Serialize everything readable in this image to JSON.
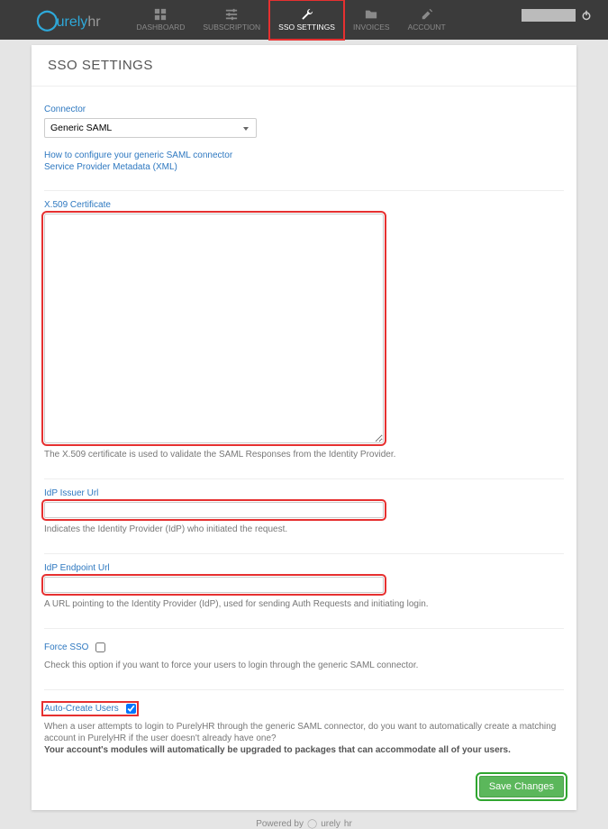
{
  "brand": {
    "prefix": "urely",
    "suffix": "hr"
  },
  "nav": {
    "dashboard": "DASHBOARD",
    "subscription": "SUBSCRIPTION",
    "sso": "SSO SETTINGS",
    "invoices": "INVOICES",
    "account": "ACCOUNT"
  },
  "page": {
    "title": "SSO SETTINGS"
  },
  "connector": {
    "label": "Connector",
    "selected": "Generic SAML",
    "link1": "How to configure your generic SAML connector",
    "link2": "Service Provider Metadata (XML)"
  },
  "cert": {
    "label": "X.509 Certificate",
    "value": "",
    "hint": "The X.509 certificate is used to validate the SAML Responses from the Identity Provider."
  },
  "issuer": {
    "label": "IdP Issuer Url",
    "value": "",
    "hint": "Indicates the Identity Provider (IdP) who initiated the request."
  },
  "endpoint": {
    "label": "IdP Endpoint Url",
    "value": "",
    "hint": "A URL pointing to the Identity Provider (IdP), used for sending Auth Requests and initiating login."
  },
  "force": {
    "label": "Force SSO",
    "checked": false,
    "hint": "Check this option if you want to force your users to login through the generic SAML connector."
  },
  "auto": {
    "label": "Auto-Create Users",
    "checked": true,
    "hint1": "When a user attempts to login to PurelyHR through the generic SAML connector, do you want to automatically create a matching account in PurelyHR if the user doesn't already have one?",
    "hint2": "Your account's modules will automatically be upgraded to packages that can accommodate all of your users."
  },
  "buttons": {
    "save": "Save Changes"
  },
  "footer": {
    "poweredBy": "Powered by",
    "brand1": "urely",
    "brand2": "hr"
  }
}
